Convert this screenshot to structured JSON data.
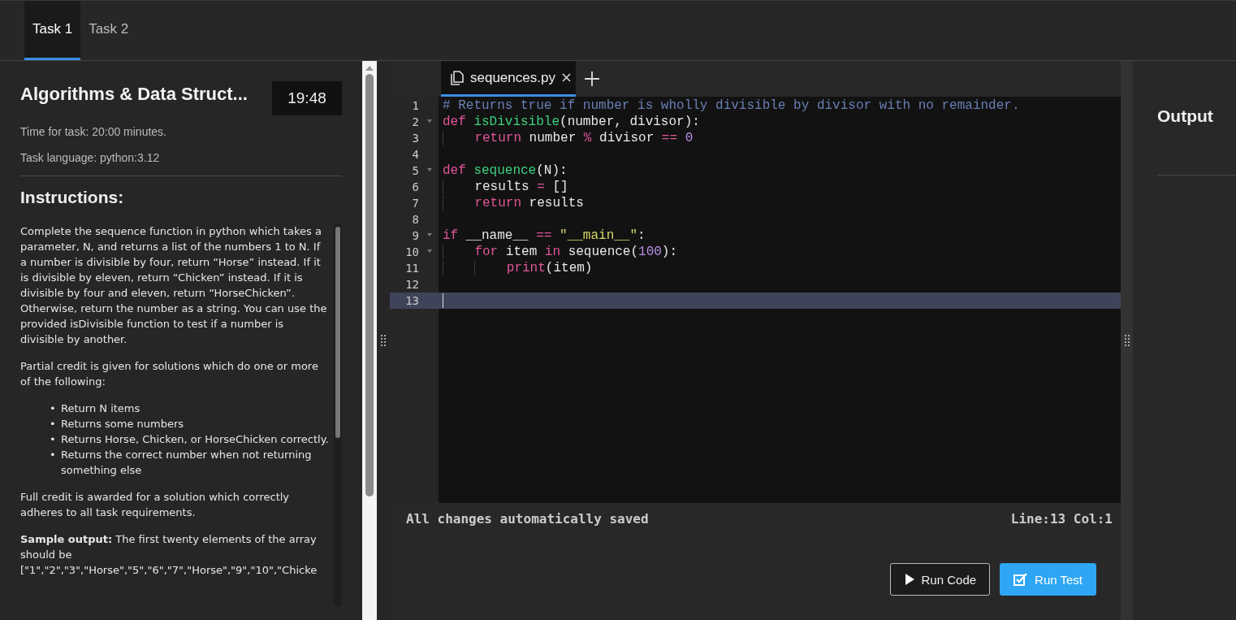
{
  "tabs": [
    {
      "label": "Task 1",
      "selected": true
    },
    {
      "label": "Task 2",
      "selected": false
    }
  ],
  "task": {
    "title": "Algorithms & Data Struct...",
    "timer": "19:48",
    "time_for_task": "Time for task: 20:00 minutes.",
    "language": "Task language: python:3.12"
  },
  "instructions": {
    "heading": "Instructions:",
    "blocks": [
      {
        "kind": "paragraph",
        "text": "Complete the sequence function in python which takes a parameter, N, and returns a list of the numbers 1 to N. If a number is divisible by four, return “Horse” instead. If it is divisible by eleven, return “Chicken” instead. If it is divisible by four and eleven, return “HorseChicken”. Otherwise, return the number as a string. You can use the provided isDivisible function to test if a number is divisible by another."
      },
      {
        "kind": "paragraph",
        "text": "Partial credit is given for solutions which do one or more of the following:"
      },
      {
        "kind": "list",
        "items": [
          {
            "marker": "•",
            "text": "Return N items"
          },
          {
            "marker": "•",
            "text": "Returns some numbers"
          },
          {
            "marker": "•",
            "text": "Returns Horse, Chicken, or HorseChicken correctly."
          },
          {
            "marker": "•",
            "text": "Returns the correct number when not returning something else"
          }
        ]
      },
      {
        "kind": "paragraph",
        "text": "Full credit is awarded for a solution which correctly adheres to all task requirements."
      },
      {
        "kind": "paragraph",
        "text": "**Sample output:** The first twenty elements of the array should be [\"1\",\"2\",\"3\",\"Horse\",\"5\",\"6\",\"7\",\"Horse\",\"9\",\"10\",\"Chicke"
      }
    ]
  },
  "editor": {
    "file_tab": {
      "name": "sequences.py",
      "selected": true
    },
    "lines": [
      {
        "n": "1",
        "foldable": false,
        "active": false,
        "tokens": [
          {
            "kind": "comment",
            "t": "# Returns true if number is wholly divisible by divisor with no remainder."
          }
        ]
      },
      {
        "n": "2",
        "foldable": true,
        "active": false,
        "tokens": [
          {
            "kind": "keyword",
            "t": "def "
          },
          {
            "kind": "func",
            "t": "isDivisible"
          },
          {
            "kind": "plain",
            "t": "(number, divisor):"
          }
        ]
      },
      {
        "n": "3",
        "foldable": false,
        "active": false,
        "tokens": [
          {
            "kind": "keyword",
            "t": "    return"
          },
          {
            "kind": "plain",
            "t": " number "
          },
          {
            "kind": "operator",
            "t": "%"
          },
          {
            "kind": "plain",
            "t": " divisor "
          },
          {
            "kind": "operator",
            "t": "== "
          },
          {
            "kind": "number",
            "t": "0"
          }
        ]
      },
      {
        "n": "4",
        "foldable": false,
        "active": false
      },
      {
        "n": "5",
        "foldable": true,
        "active": false,
        "tokens": [
          {
            "kind": "keyword",
            "t": "def "
          },
          {
            "kind": "func",
            "t": "sequence"
          },
          {
            "kind": "plain",
            "t": "(N):"
          }
        ]
      },
      {
        "n": "6",
        "foldable": false,
        "active": false,
        "tokens": [
          {
            "kind": "plain",
            "t": "    results "
          },
          {
            "kind": "operator",
            "t": "="
          },
          {
            "kind": "plain",
            "t": " []"
          }
        ]
      },
      {
        "n": "7",
        "foldable": false,
        "active": false,
        "tokens": [
          {
            "kind": "keyword",
            "t": "    return"
          },
          {
            "kind": "plain",
            "t": " results"
          }
        ]
      },
      {
        "n": "8",
        "foldable": false,
        "active": false
      },
      {
        "n": "9",
        "foldable": true,
        "active": false,
        "tokens": [
          {
            "kind": "keyword",
            "t": "if"
          },
          {
            "kind": "plain",
            "t": " __name__ "
          },
          {
            "kind": "operator",
            "t": "== "
          },
          {
            "kind": "string",
            "t": "\"__main__\""
          },
          {
            "kind": "plain",
            "t": ":"
          }
        ]
      },
      {
        "n": "10",
        "foldable": true,
        "active": false,
        "tokens": [
          {
            "kind": "keyword",
            "t": "    for"
          },
          {
            "kind": "plain",
            "t": " item "
          },
          {
            "kind": "keyword",
            "t": "in"
          },
          {
            "kind": "plain",
            "t": " sequence("
          },
          {
            "kind": "number",
            "t": "100"
          },
          {
            "kind": "plain",
            "t": "):"
          }
        ]
      },
      {
        "n": "11",
        "foldable": false,
        "active": false,
        "tokens": [
          {
            "kind": "keyword",
            "t": "        print"
          },
          {
            "kind": "plain",
            "t": "(item)"
          }
        ]
      },
      {
        "n": "12",
        "foldable": false,
        "active": false
      },
      {
        "n": "13",
        "foldable": false,
        "active": true
      }
    ],
    "save_status": "All changes automatically saved",
    "cursor_position": "Line:13 Col:1",
    "buttons": [
      {
        "label": "Run Code",
        "kind": "outline"
      },
      {
        "label": "Run Test",
        "kind": "primary"
      }
    ]
  },
  "output": {
    "title": "Output"
  }
}
